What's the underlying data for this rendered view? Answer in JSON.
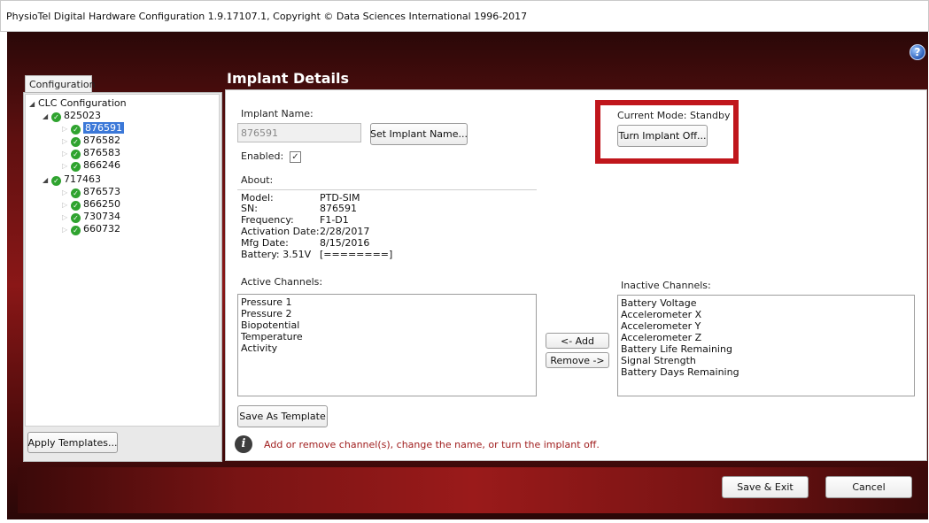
{
  "window": {
    "title": "PhysioTel Digital Hardware Configuration 1.9.17107.1, Copyright © Data Sciences International 1996-2017"
  },
  "help_icon": {
    "glyph": "?"
  },
  "sidebar": {
    "tab_label": "Configuration",
    "tree": {
      "root_label": "CLC Configuration",
      "groups": [
        {
          "label": "825023",
          "children": [
            "876591",
            "876582",
            "876583",
            "866246"
          ]
        },
        {
          "label": "717463",
          "children": [
            "876573",
            "866250",
            "730734",
            "660732"
          ]
        }
      ],
      "selected": "876591"
    },
    "apply_templates_label": "Apply Templates..."
  },
  "main": {
    "title": "Implant Details",
    "implant_name_label": "Implant Name:",
    "implant_name_value": "876591",
    "set_name_button": "Set Implant Name...",
    "enabled_label": "Enabled:",
    "enabled_checked": true,
    "about_label": "About:",
    "about": {
      "model_key": "Model:",
      "model_val": "PTD-SIM",
      "sn_key": "SN:",
      "sn_val": "876591",
      "freq_key": "Frequency:",
      "freq_val": "F1-D1",
      "act_key": "Activation Date:",
      "act_val": "2/28/2017",
      "mfg_key": "Mfg Date:",
      "mfg_val": "8/15/2016",
      "battery_key": "Battery: 3.51V",
      "battery_val": "[========]"
    },
    "current_mode": "Current Mode: Standby",
    "turn_off_button": "Turn Implant Off...",
    "active_channels_label": "Active Channels:",
    "active_channels": [
      "Pressure 1",
      "Pressure 2",
      "Biopotential",
      "Temperature",
      "Activity"
    ],
    "inactive_channels_label": "Inactive Channels:",
    "inactive_channels": [
      "Battery Voltage",
      "Accelerometer X",
      "Accelerometer Y",
      "Accelerometer Z",
      "Battery Life Remaining",
      "Signal Strength",
      "Battery Days Remaining"
    ],
    "add_button": "<- Add",
    "remove_button": "Remove ->",
    "save_template_button": "Save As Template",
    "info_message": "Add or remove channel(s), change the name, or turn the implant off."
  },
  "footer": {
    "save_exit_label": "Save & Exit",
    "cancel_label": "Cancel"
  },
  "colors": {
    "highlight": "#c0161c",
    "frame_red": "#8a1717",
    "selection": "#3b78d8",
    "status_ok": "#2fa32f"
  }
}
